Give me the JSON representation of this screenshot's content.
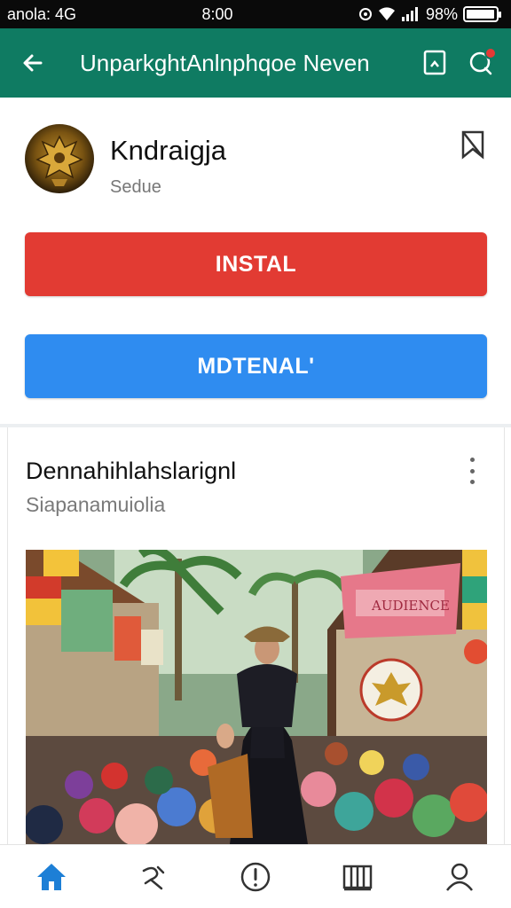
{
  "status_bar": {
    "carrier": "anola: 4G",
    "time": "8:00",
    "battery": "98%",
    "battery_level": 0.98
  },
  "app_bar": {
    "title": "UnparkghtAnlnphqoe Neven",
    "back_icon": "back-arrow-icon",
    "save_icon": "bookmark-icon",
    "chat_icon": "chat-notification-icon"
  },
  "app_header": {
    "name": "Kndraigja",
    "subtitle": "Sedue"
  },
  "buttons": {
    "install_label": "INSTAL",
    "secondary_label": "MDTENAL'"
  },
  "post": {
    "title": "Dennahihlahslarignl",
    "subtitle": "Siapanamuiolia",
    "banner_text": "AUDIENCE"
  },
  "bottom_nav": {
    "items": [
      {
        "icon": "home-icon"
      },
      {
        "icon": "explore-icon"
      },
      {
        "icon": "alert-icon"
      },
      {
        "icon": "library-icon"
      },
      {
        "icon": "profile-icon"
      }
    ]
  },
  "colors": {
    "app_bar": "#0f7b62",
    "install_button": "#e23b33",
    "secondary_button": "#2f8cf0",
    "nav_active": "#1d7fd6",
    "notification": "#e53935"
  }
}
